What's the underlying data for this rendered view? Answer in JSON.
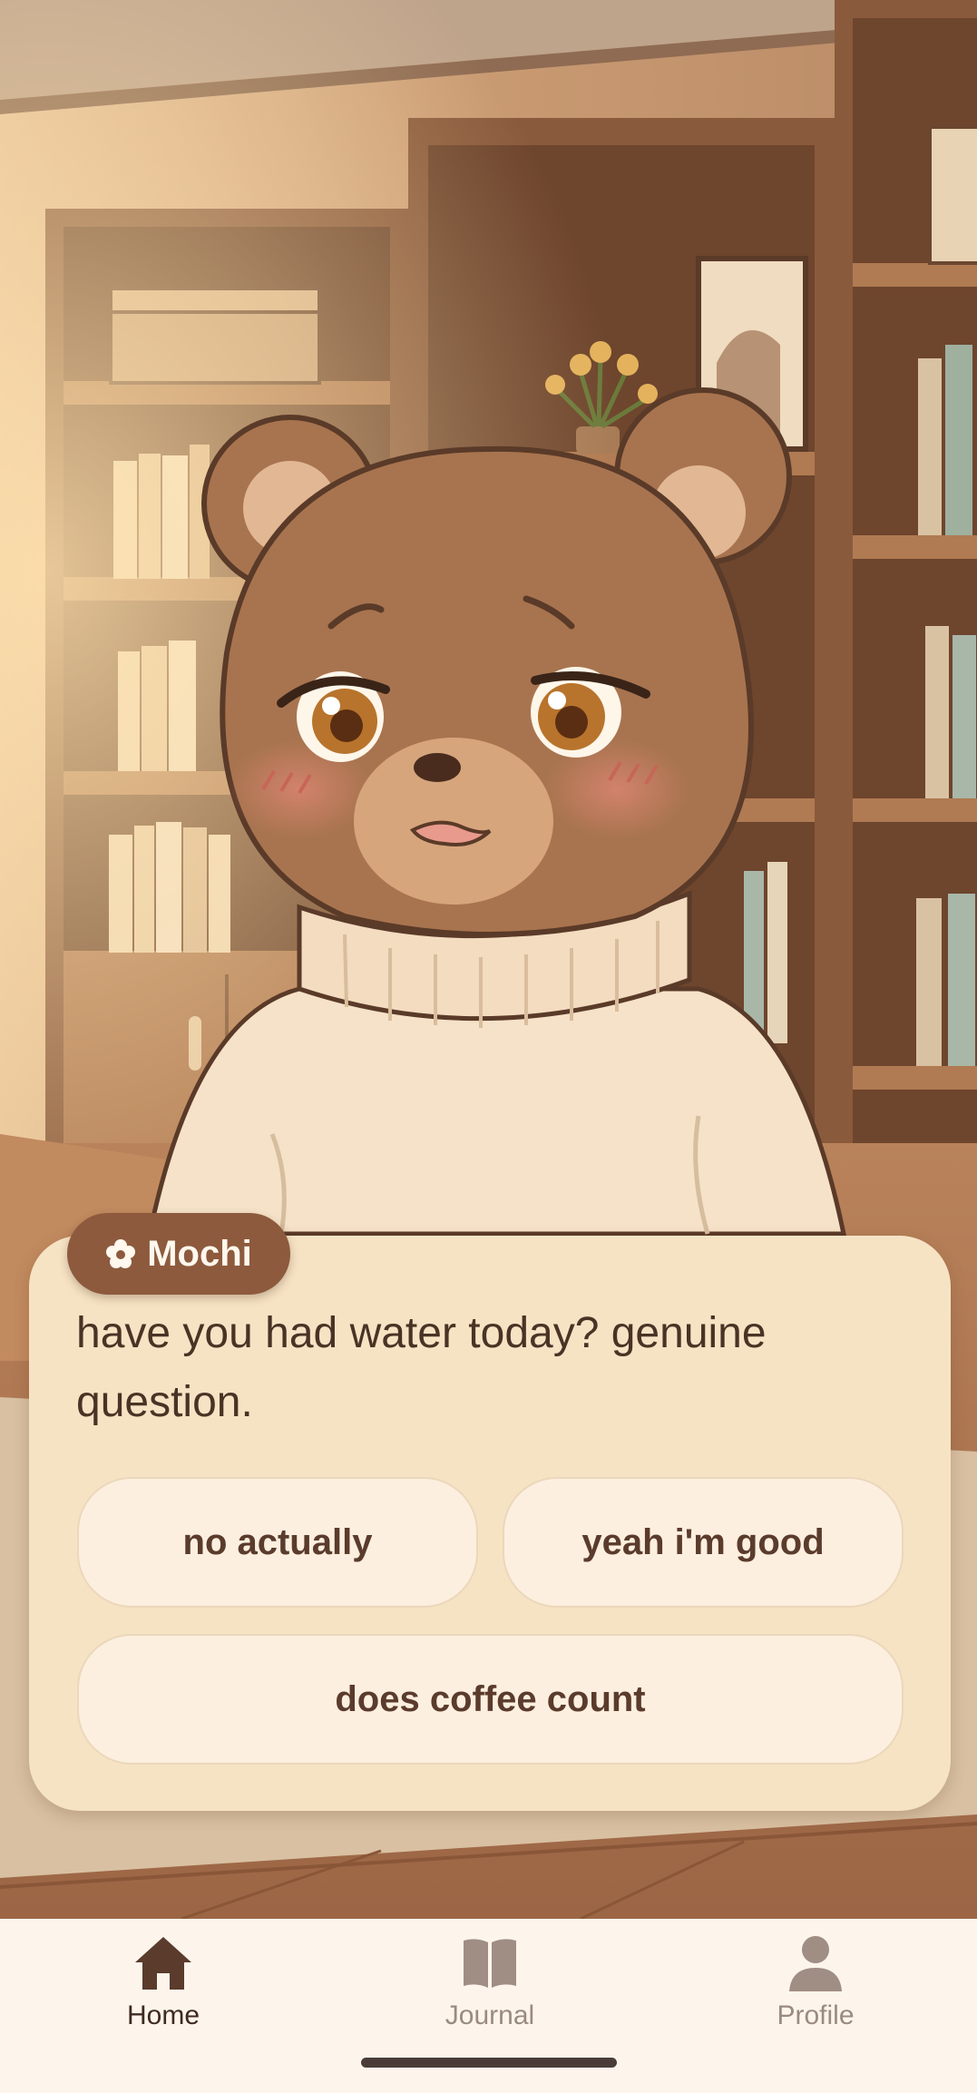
{
  "character": {
    "name": "Mochi",
    "name_icon": "flower-icon"
  },
  "dialog": {
    "message": "have you had water today? genuine question.",
    "choices": [
      "no actually",
      "yeah i'm good",
      "does coffee count"
    ]
  },
  "bottom_nav": {
    "items": [
      {
        "label": "Home",
        "icon": "home-icon",
        "active": true
      },
      {
        "label": "Journal",
        "icon": "book-icon",
        "active": false
      },
      {
        "label": "Profile",
        "icon": "person-icon",
        "active": false
      }
    ]
  },
  "colors": {
    "accent": "#8d5a3d",
    "dialog_bg": "#f6e3c4",
    "choice_bg": "#fcefdf",
    "text_dark": "#4a3225",
    "nav_active": "#5a3b2c",
    "nav_inactive": "#a08d84"
  }
}
